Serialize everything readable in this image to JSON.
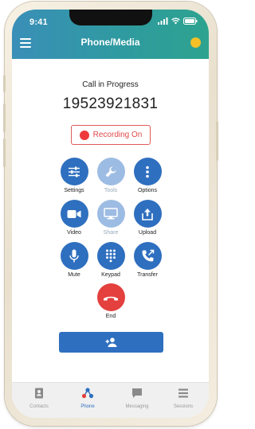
{
  "status_bar": {
    "time": "9:41"
  },
  "header": {
    "title": "Phone/Media"
  },
  "call": {
    "status": "Call in Progress",
    "number": "19523921831",
    "recording_label": "Recording On"
  },
  "controls": [
    {
      "label": "Settings",
      "icon": "sliders-icon",
      "enabled": true
    },
    {
      "label": "Tools",
      "icon": "wrench-icon",
      "enabled": false
    },
    {
      "label": "Options",
      "icon": "vertical-dots-icon",
      "enabled": true
    },
    {
      "label": "Video",
      "icon": "video-camera-icon",
      "enabled": true
    },
    {
      "label": "Share",
      "icon": "monitor-icon",
      "enabled": false
    },
    {
      "label": "Upload",
      "icon": "upload-icon",
      "enabled": true
    },
    {
      "label": "Mute",
      "icon": "microphone-icon",
      "enabled": true
    },
    {
      "label": "Keypad",
      "icon": "keypad-icon",
      "enabled": true
    },
    {
      "label": "Transfer",
      "icon": "phone-transfer-icon",
      "enabled": true
    }
  ],
  "end": {
    "label": "End",
    "icon": "hang-up-icon"
  },
  "action_button": {
    "icon": "add-person-icon"
  },
  "tabs": [
    {
      "label": "Contacts",
      "icon": "contacts-icon",
      "active": false
    },
    {
      "label": "Phone",
      "icon": "phone-network-icon",
      "active": true
    },
    {
      "label": "Messaging",
      "icon": "chat-icon",
      "active": false
    },
    {
      "label": "Sessions",
      "icon": "list-icon",
      "active": false
    }
  ],
  "colors": {
    "accent": "#2e6fbf",
    "accent_disabled": "#9dbce3",
    "header_start": "#3a8fb8",
    "header_end": "#2ea38f",
    "recording": "#e04848",
    "end": "#e3403e",
    "avatar": "#f5c028"
  }
}
